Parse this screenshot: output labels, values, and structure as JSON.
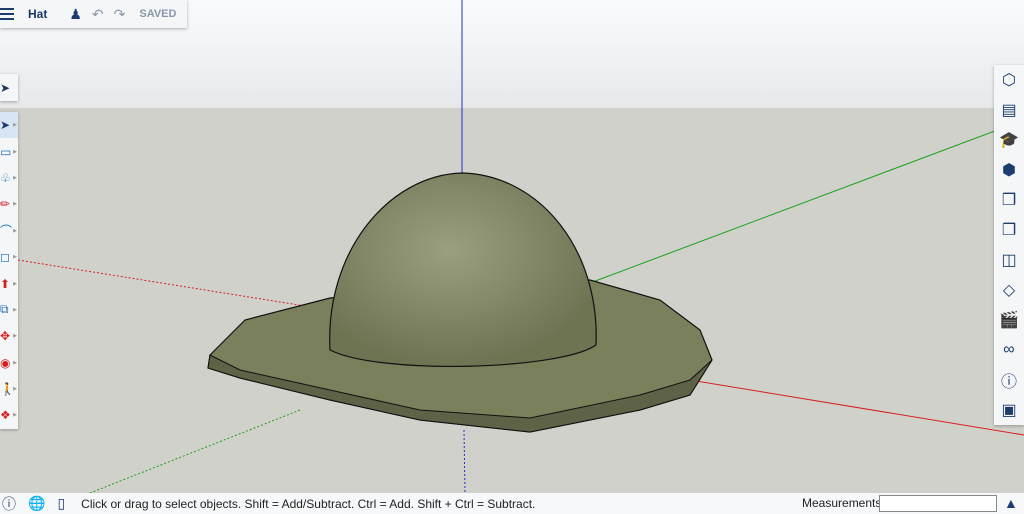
{
  "topbar": {
    "title": "Hat",
    "saved": "SAVED"
  },
  "status": {
    "message": "Click or drag to select objects. Shift = Add/Subtract. Ctrl = Add. Shift + Ctrl = Subtract.",
    "measurements_label": "Measurements",
    "measurements_value": ""
  },
  "left_tools": [
    "select",
    "eraser",
    "paint-bucket",
    "pencil",
    "arc",
    "rectangle",
    "push-pull",
    "offset",
    "move",
    "orbit",
    "walk",
    "section-plane"
  ],
  "right_tools": [
    "search",
    "outliner",
    "instructor",
    "components",
    "materials",
    "styles",
    "entity-info",
    "tags",
    "scenes",
    "display",
    "info",
    "extension-warehouse"
  ],
  "colors": {
    "x_axis": "#d42020",
    "y_axis": "#1aa01a",
    "z_axis": "#2030d0",
    "hat": "#7d8260"
  }
}
